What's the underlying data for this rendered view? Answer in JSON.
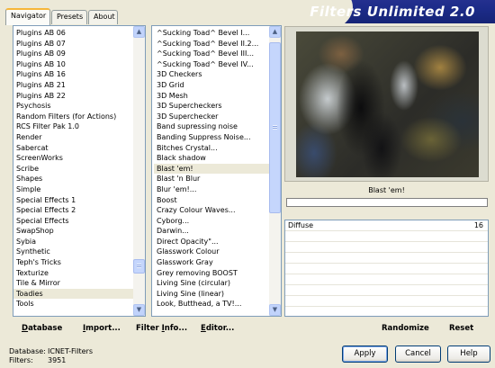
{
  "tabs": [
    {
      "label": "Navigator",
      "active": true
    },
    {
      "label": "Presets",
      "active": false
    },
    {
      "label": "About",
      "active": false
    }
  ],
  "header": {
    "title": "Filters Unlimited 2.0"
  },
  "categories": {
    "items": [
      "Plugins AB 06",
      "Plugins AB 07",
      "Plugins AB 09",
      "Plugins AB 10",
      "Plugins AB 16",
      "Plugins AB 21",
      "Plugins AB 22",
      "Psychosis",
      "Random Filters (for Actions)",
      "RCS Filter Pak 1.0",
      "Render",
      "Sabercat",
      "ScreenWorks",
      "Scribe",
      "Shapes",
      "Simple",
      "Special Effects 1",
      "Special Effects 2",
      "Special Effects",
      "SwapShop",
      "Sybia",
      "Synthetic",
      "Teph's Tricks",
      "Texturize",
      "Tile & Mirror",
      "Toadies",
      "Tools"
    ],
    "selected": "Toadies",
    "scroll_position": 0.88
  },
  "filters": {
    "items": [
      "^Sucking Toad^ Bevel I...",
      "^Sucking Toad^ Bevel II.2...",
      "^Sucking Toad^ Bevel III...",
      "^Sucking Toad^ Bevel IV...",
      "3D Checkers",
      "3D Grid",
      "3D Mesh",
      "3D Supercheckers",
      "3D Superchecker",
      "Band supressing noise",
      "Banding Suppress Noise...",
      "Bitches Crystal...",
      "Black shadow",
      "Blast 'em!",
      "Blast 'n Blur",
      "Blur 'em!...",
      "Boost",
      "Crazy Colour Waves...",
      "Cyborg...",
      "Darwin...",
      "Direct Opacity\"...",
      "Glasswork Colour",
      "Glasswork Gray",
      "Grey removing BOOST",
      "Living Sine (circular)",
      "Living Sine (linear)",
      "Look, Butthead, a TV!..."
    ],
    "selected": "Blast 'em!",
    "scroll_position": 0.05
  },
  "preview": {
    "filter_name": "Blast 'em!",
    "progress": 0.0
  },
  "parameters": [
    {
      "label": "Diffuse",
      "value": "16"
    }
  ],
  "toolbar": {
    "database": "Database",
    "database_u": "D",
    "import": "Import...",
    "import_u": "I",
    "filter_info": "Filter Info...",
    "filter_info_u": "I",
    "editor": "Editor...",
    "editor_u": "E",
    "randomize": "Randomize",
    "reset": "Reset"
  },
  "footer": {
    "database_label": "Database:",
    "database_value": "ICNET-Filters",
    "filters_label": "Filters:",
    "filters_value": "3951"
  },
  "buttons": {
    "apply": "Apply",
    "cancel": "Cancel",
    "help": "Help"
  },
  "colors": {
    "accent": "#1c2b88",
    "window_bg": "#ece9d8",
    "tab_highlight": "#f6b73a"
  }
}
